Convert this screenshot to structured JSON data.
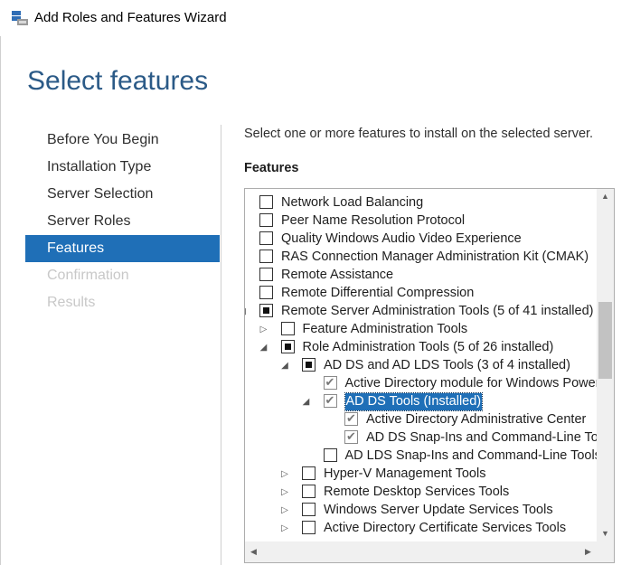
{
  "window": {
    "title": "Add Roles and Features Wizard",
    "icon": "server-manager-icon"
  },
  "page": {
    "title": "Select features"
  },
  "nav": {
    "items": [
      {
        "label": "Before You Begin",
        "state": "normal"
      },
      {
        "label": "Installation Type",
        "state": "normal"
      },
      {
        "label": "Server Selection",
        "state": "normal"
      },
      {
        "label": "Server Roles",
        "state": "normal"
      },
      {
        "label": "Features",
        "state": "active"
      },
      {
        "label": "Confirmation",
        "state": "disabled"
      },
      {
        "label": "Results",
        "state": "disabled"
      }
    ]
  },
  "content": {
    "instruction": "Select one or more features to install on the selected server.",
    "section_label": "Features"
  },
  "tree": {
    "items": [
      {
        "label": "Network Load Balancing",
        "level": 0,
        "expander": "none",
        "check": "unchecked"
      },
      {
        "label": "Peer Name Resolution Protocol",
        "level": 0,
        "expander": "none",
        "check": "unchecked"
      },
      {
        "label": "Quality Windows Audio Video Experience",
        "level": 0,
        "expander": "none",
        "check": "unchecked"
      },
      {
        "label": "RAS Connection Manager Administration Kit (CMAK)",
        "level": 0,
        "expander": "none",
        "check": "unchecked"
      },
      {
        "label": "Remote Assistance",
        "level": 0,
        "expander": "none",
        "check": "unchecked"
      },
      {
        "label": "Remote Differential Compression",
        "level": 0,
        "expander": "none",
        "check": "unchecked"
      },
      {
        "label": "Remote Server Administration Tools (5 of 41 installed)",
        "level": 0,
        "expander": "expanded",
        "check": "partial"
      },
      {
        "label": "Feature Administration Tools",
        "level": 1,
        "expander": "collapsed",
        "check": "unchecked"
      },
      {
        "label": "Role Administration Tools (5 of 26 installed)",
        "level": 1,
        "expander": "expanded",
        "check": "partial"
      },
      {
        "label": "AD DS and AD LDS Tools (3 of 4 installed)",
        "level": 2,
        "expander": "expanded",
        "check": "partial"
      },
      {
        "label": "Active Directory module for Windows PowerShell",
        "level": 3,
        "expander": "none",
        "check": "checked"
      },
      {
        "label": "AD DS Tools (Installed)",
        "level": 3,
        "expander": "expanded",
        "check": "checked",
        "selected": true
      },
      {
        "label": "Active Directory Administrative Center",
        "level": 4,
        "expander": "none",
        "check": "checked"
      },
      {
        "label": "AD DS Snap-Ins and Command-Line Tools",
        "level": 4,
        "expander": "none",
        "check": "checked"
      },
      {
        "label": "AD LDS Snap-Ins and Command-Line Tools",
        "level": 3,
        "expander": "none",
        "check": "unchecked"
      },
      {
        "label": "Hyper-V Management Tools",
        "level": 2,
        "expander": "collapsed",
        "check": "unchecked"
      },
      {
        "label": "Remote Desktop Services Tools",
        "level": 2,
        "expander": "collapsed",
        "check": "unchecked"
      },
      {
        "label": "Windows Server Update Services Tools",
        "level": 2,
        "expander": "collapsed",
        "check": "unchecked"
      },
      {
        "label": "Active Directory Certificate Services Tools",
        "level": 2,
        "expander": "collapsed",
        "check": "unchecked"
      }
    ]
  },
  "colors": {
    "accent": "#1f6fb7",
    "title": "#2b5a87",
    "disabled": "#c8c8c8"
  }
}
